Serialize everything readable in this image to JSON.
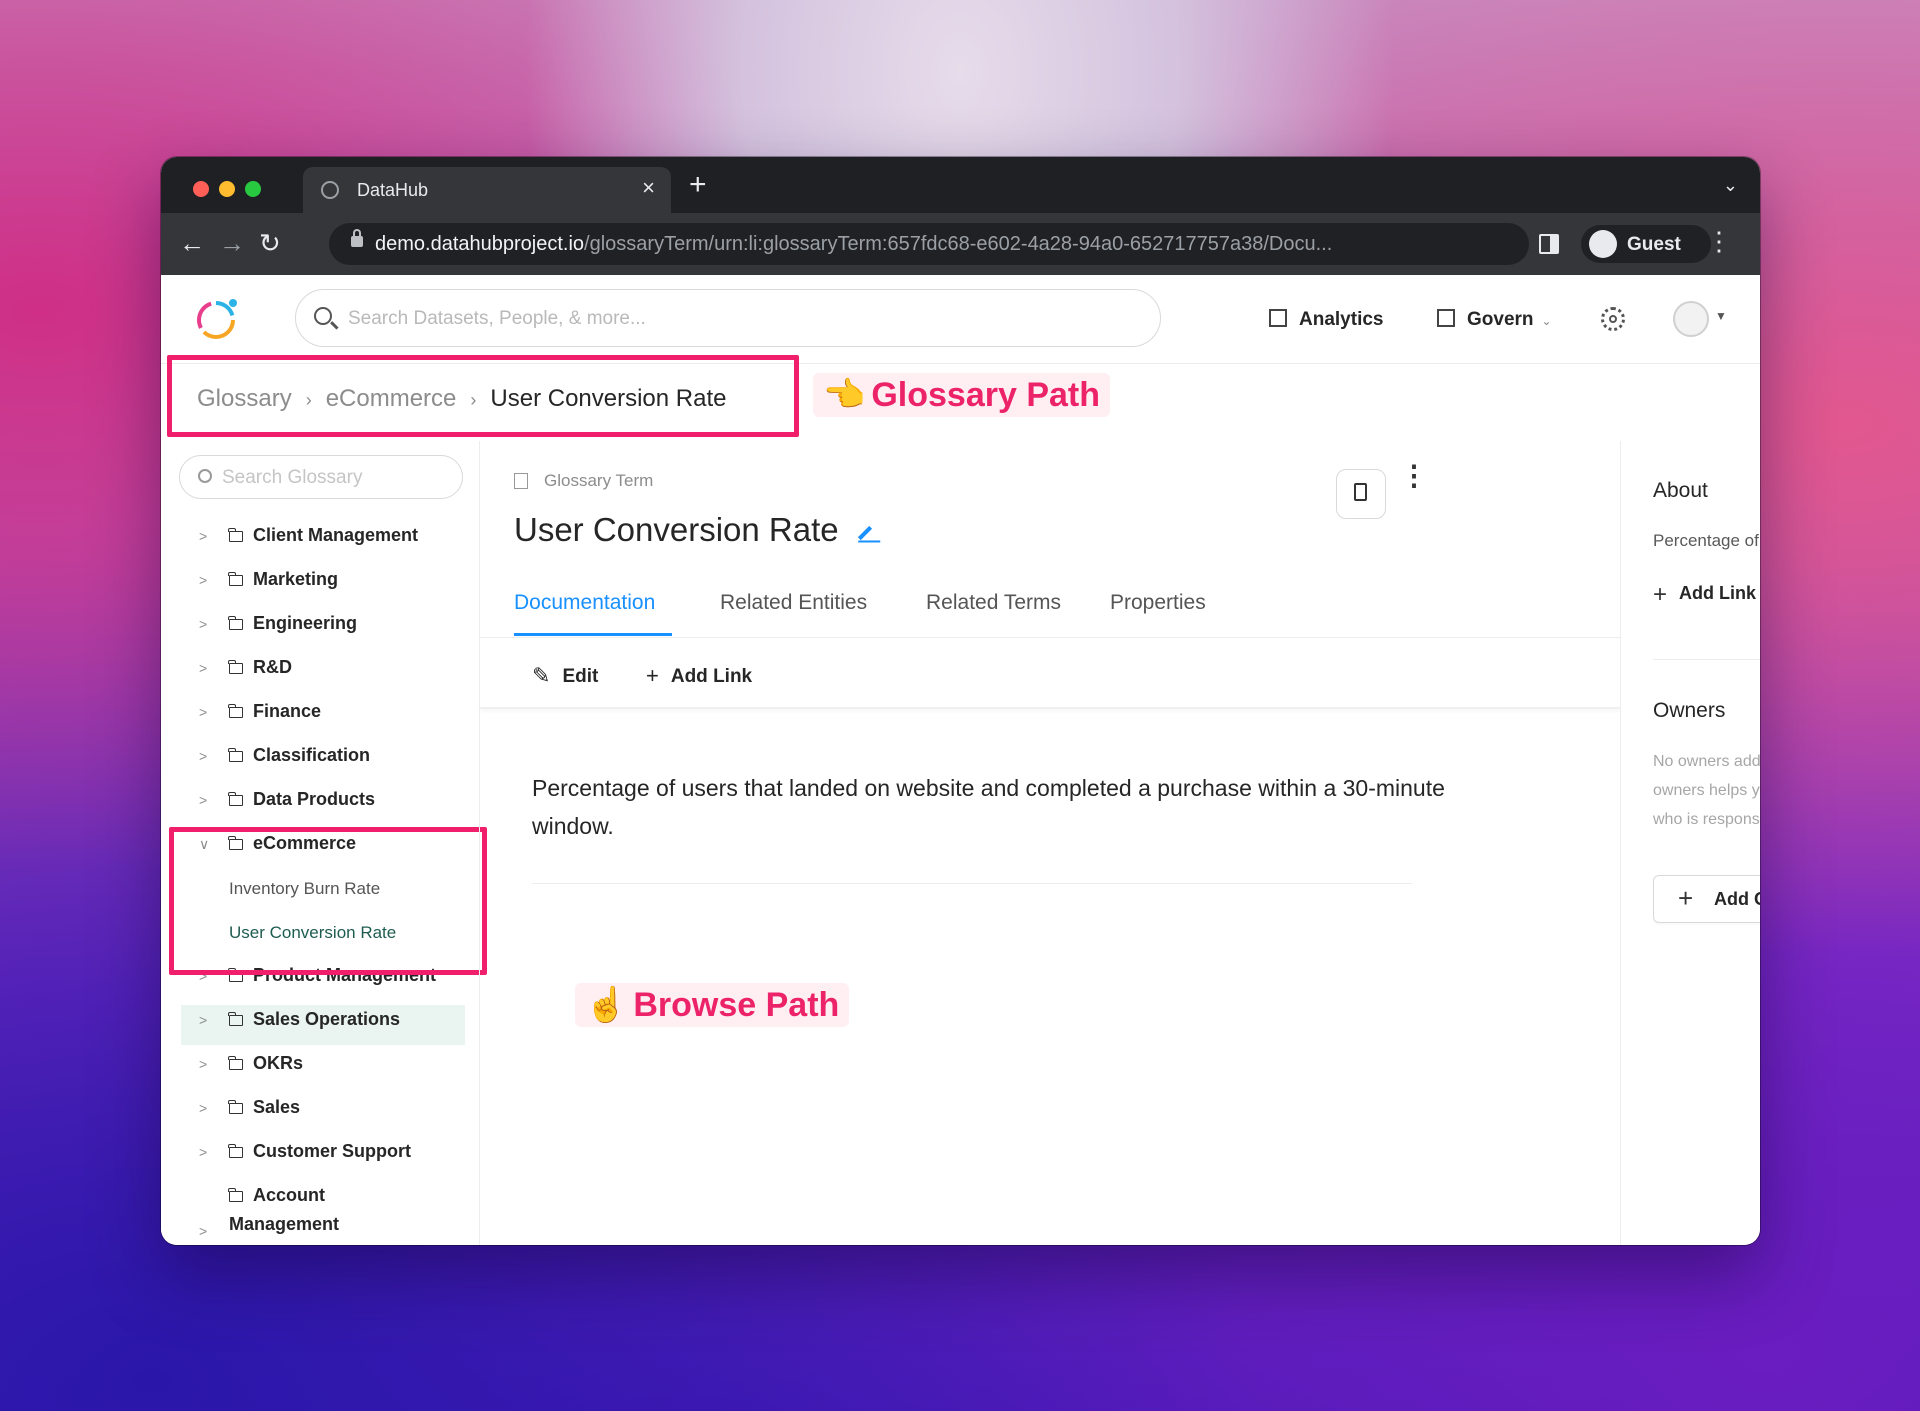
{
  "browser": {
    "tab_title": "DataHub",
    "tab_close": "×",
    "new_tab": "+",
    "url_host": "demo.datahubproject.io",
    "url_path": "/glossaryTerm/urn:li:glossaryTerm:657fdc68-e602-4a28-94a0-652717757a38/Docu...",
    "profile_label": "Guest",
    "traffic_colors": [
      "#ff5f57",
      "#febc2e",
      "#28c840"
    ]
  },
  "header": {
    "search_placeholder": "Search Datasets, People, & more...",
    "analytics_label": "Analytics",
    "govern_label": "Govern"
  },
  "breadcrumb": {
    "items": [
      "Glossary",
      "eCommerce",
      "User Conversion Rate"
    ]
  },
  "annotations": {
    "glossary_path": "Glossary Path",
    "browse_path": "Browse Path",
    "glossary_path_emoji": "👈",
    "browse_path_emoji": "☝",
    "highlight_color": "#ef1f6b"
  },
  "sidebar": {
    "search_placeholder": "Search Glossary",
    "nodes": [
      "Client Management",
      "Marketing",
      "Engineering",
      "R&D",
      "Finance",
      "Classification",
      "Data Products",
      "eCommerce",
      "Product Management",
      "Sales Operations",
      "OKRs",
      "Sales",
      "Customer Support"
    ],
    "ecommerce_terms": [
      "Inventory Burn Rate",
      "User Conversion Rate"
    ],
    "last_node": [
      "Account",
      "Management"
    ]
  },
  "main": {
    "entity_type": "Glossary Term",
    "title": "User Conversion Rate",
    "tabs": [
      "Documentation",
      "Related Entities",
      "Related Terms",
      "Properties"
    ],
    "active_tab": "Documentation",
    "edit_label": "Edit",
    "add_link_label": "Add Link",
    "documentation": "Percentage of users that landed on website and completed a purchase within a 30-minute window.",
    "accent_color": "#1890ff"
  },
  "about": {
    "heading": "About",
    "summary": "Percentage of users that l...",
    "add_link_label": "Add Link"
  },
  "owners": {
    "heading": "Owners",
    "empty_message": "No owners added yet. Adding owners helps you keep track of who is responsible for this data.",
    "add_label": "Add Owners"
  }
}
